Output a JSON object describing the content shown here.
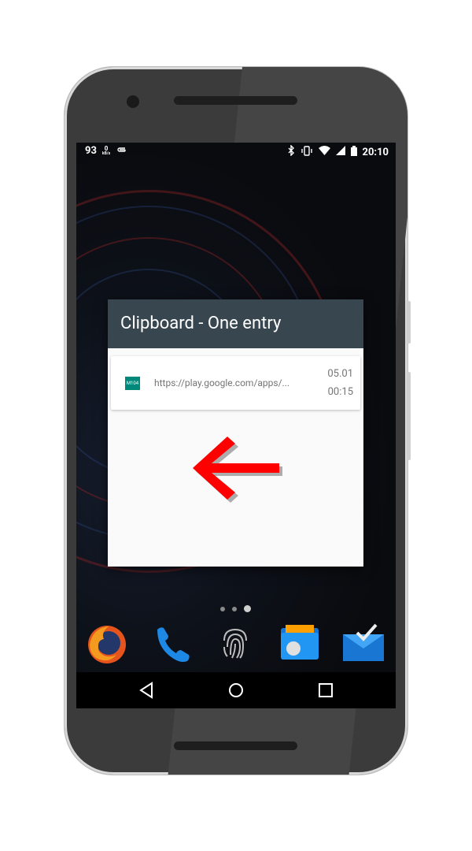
{
  "status_bar": {
    "battery_percent": "93",
    "network_speed_value": "0",
    "network_speed_unit": "kB/s",
    "time": "20:10",
    "icons": [
      "paperclip-icon",
      "bluetooth-icon",
      "vibrate-icon",
      "wifi-icon",
      "cell-signal-icon",
      "battery-icon"
    ]
  },
  "dialog": {
    "title": "Clipboard - One entry",
    "entries": [
      {
        "app_icon_label": "M104",
        "text": "https://play.google.com/apps/...",
        "date": "05.01",
        "time": "00:15"
      }
    ]
  },
  "annotation": {
    "type": "arrow",
    "color": "#ff0000",
    "direction": "left"
  },
  "home_screen": {
    "page_indicator": {
      "count": 3,
      "active_index": 2
    },
    "dock_apps": [
      "firefox-icon",
      "phone-icon",
      "fingerprint-icon",
      "folder-app-icon",
      "inbox-icon"
    ]
  },
  "nav_bar": [
    "back-icon",
    "home-icon",
    "recents-icon"
  ],
  "colors": {
    "dialog_header": "#37464f",
    "dialog_body": "#fafafa",
    "app_icon": "#00897b",
    "arrow": "#ff0000"
  }
}
